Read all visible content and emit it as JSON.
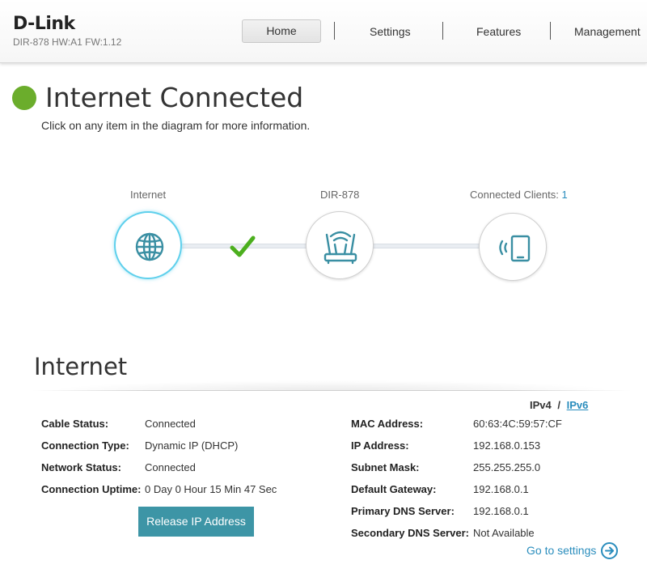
{
  "header": {
    "logo": "D-Link",
    "model_info": "DIR-878 HW:A1 FW:1.12",
    "nav": [
      "Home",
      "Settings",
      "Features",
      "Management"
    ]
  },
  "status": {
    "title": "Internet Connected",
    "subtitle": "Click on any item in the diagram for more information."
  },
  "diagram": {
    "internet_label": "Internet",
    "router_label": "DIR-878",
    "clients_label": "Connected Clients:",
    "clients_count": "1"
  },
  "section": {
    "title": "Internet",
    "ipv4": "IPv4",
    "separator": "/",
    "ipv6": "IPv6"
  },
  "left_fields": [
    {
      "label": "Cable Status:",
      "value": "Connected"
    },
    {
      "label": "Connection Type:",
      "value": "Dynamic IP (DHCP)"
    },
    {
      "label": "Network Status:",
      "value": "Connected"
    },
    {
      "label": "Connection Uptime:",
      "value": "0 Day 0 Hour 15 Min 47 Sec"
    }
  ],
  "right_fields": [
    {
      "label": "MAC Address:",
      "value": "60:63:4C:59:57:CF"
    },
    {
      "label": "IP Address:",
      "value": "192.168.0.153"
    },
    {
      "label": "Subnet Mask:",
      "value": "255.255.255.0"
    },
    {
      "label": "Default Gateway:",
      "value": "192.168.0.1"
    },
    {
      "label": "Primary DNS Server:",
      "value": "192.168.0.1"
    },
    {
      "label": "Secondary DNS Server:",
      "value": "Not Available"
    }
  ],
  "actions": {
    "release_label": "Release IP Address",
    "goto_label": "Go to settings"
  },
  "colors": {
    "status_green": "#6bad2c",
    "accent_teal": "#3d95a6",
    "link_blue": "#2a8dbd",
    "icon_teal": "#3a8fa3"
  }
}
